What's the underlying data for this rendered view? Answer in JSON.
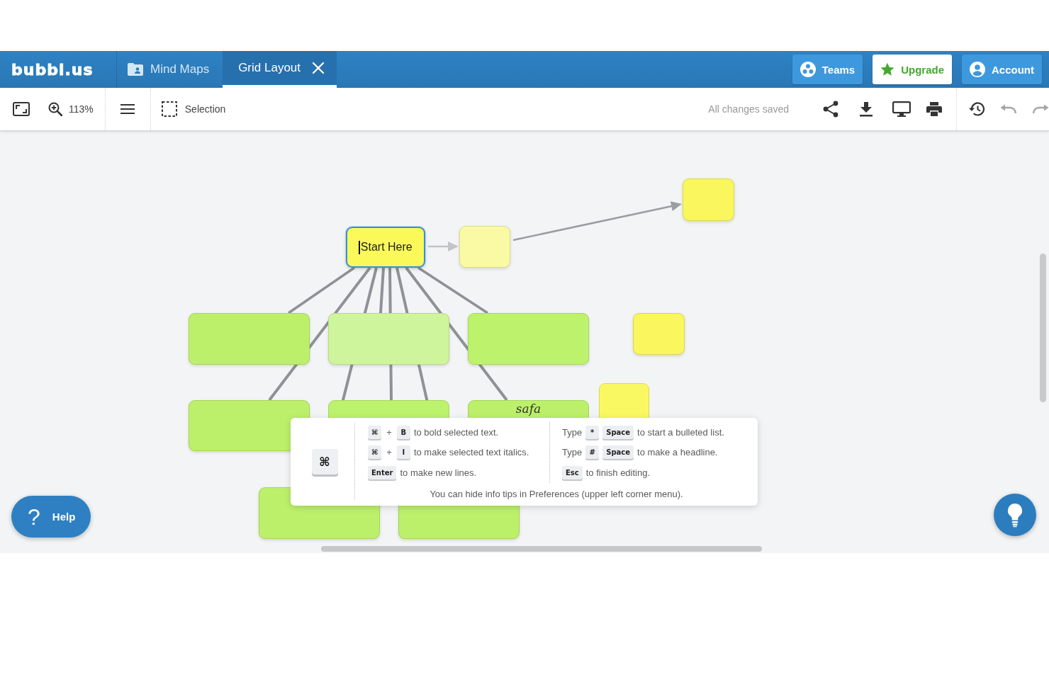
{
  "header": {
    "logo": "bubbl.us",
    "tabs": [
      {
        "label": "Mind Maps",
        "kind": "browser",
        "selected": false
      },
      {
        "label": "Grid Layout",
        "kind": "document",
        "selected": true
      }
    ],
    "buttons": [
      {
        "label": "Teams",
        "kind": "teams"
      },
      {
        "label": "Upgrade",
        "kind": "upgrade"
      },
      {
        "label": "Account",
        "kind": "account"
      }
    ]
  },
  "toolbar": {
    "zoom": "113%",
    "selection_tool": "Selection",
    "save_status": "All changes saved",
    "history_buttons": [
      {
        "kind": "history",
        "disabled": false
      },
      {
        "kind": "undo",
        "disabled": true
      },
      {
        "kind": "redo",
        "disabled": true
      }
    ]
  },
  "canvas": {
    "nodes": [
      {
        "text": "Start Here",
        "color": "#fbf95a",
        "selected": true,
        "editing": true,
        "children": [
          {
            "kind": "arrow",
            "color": "#fbfaa4",
            "selected": false,
            "editing": false,
            "children": [
              {
                "kind": "arrow",
                "color": "#f9f65e",
                "selected": false,
                "editing": false
              }
            ]
          },
          {
            "kind": "line",
            "color": "#bcf06a",
            "selected": false,
            "editing": false
          },
          {
            "kind": "line",
            "color": "#cff59c",
            "selected": false,
            "editing": false
          },
          {
            "kind": "line",
            "color": "#bdf26c",
            "selected": false,
            "editing": false
          },
          {
            "kind": "line",
            "color": "#bcf06a",
            "selected": false,
            "editing": false
          },
          {
            "kind": "line",
            "color": "#bdf26c",
            "selected": false,
            "editing": false
          },
          {
            "kind": "line",
            "text": "safa",
            "color": "#bcf06a",
            "selected": false,
            "editing": false
          },
          {
            "kind": "line",
            "color": "#bcf06a",
            "selected": false,
            "editing": false
          },
          {
            "kind": "line",
            "color": "#bcf06a",
            "selected": false,
            "editing": false
          }
        ]
      },
      {
        "color": "#f9f65e",
        "selected": false,
        "editing": false
      },
      {
        "color": "#faf862",
        "selected": false,
        "editing": false
      }
    ]
  },
  "info_tip": {
    "badge_key": "⌘",
    "columns": [
      {
        "rows": [
          {
            "parts": [
              {
                "kind": "key",
                "text": "⌘"
              },
              {
                "kind": "plus",
                "text": "+"
              },
              {
                "kind": "key",
                "text": "B"
              },
              {
                "kind": "text",
                "text": "to bold selected text."
              }
            ]
          },
          {
            "parts": [
              {
                "kind": "key",
                "text": "⌘"
              },
              {
                "kind": "plus",
                "text": "+"
              },
              {
                "kind": "key",
                "text": "I"
              },
              {
                "kind": "text",
                "text": "to make selected text italics."
              }
            ]
          },
          {
            "parts": [
              {
                "kind": "key",
                "text": "Enter"
              },
              {
                "kind": "text",
                "text": "to make new lines."
              }
            ]
          }
        ]
      },
      {
        "rows": [
          {
            "parts": [
              {
                "kind": "text",
                "text": "Type"
              },
              {
                "kind": "key",
                "text": "*"
              },
              {
                "kind": "key",
                "text": "Space"
              },
              {
                "kind": "text",
                "text": "to start a bulleted list."
              }
            ]
          },
          {
            "parts": [
              {
                "kind": "text",
                "text": "Type"
              },
              {
                "kind": "key",
                "text": "#"
              },
              {
                "kind": "key",
                "text": "Space"
              },
              {
                "kind": "text",
                "text": "to make a headline."
              }
            ]
          },
          {
            "parts": [
              {
                "kind": "key",
                "text": "Esc"
              },
              {
                "kind": "text",
                "text": "to finish editing."
              }
            ]
          }
        ]
      }
    ],
    "footer": "You can hide info tips in Preferences (upper left corner menu)."
  },
  "help_button": {
    "icon": "?",
    "label": "Help"
  }
}
